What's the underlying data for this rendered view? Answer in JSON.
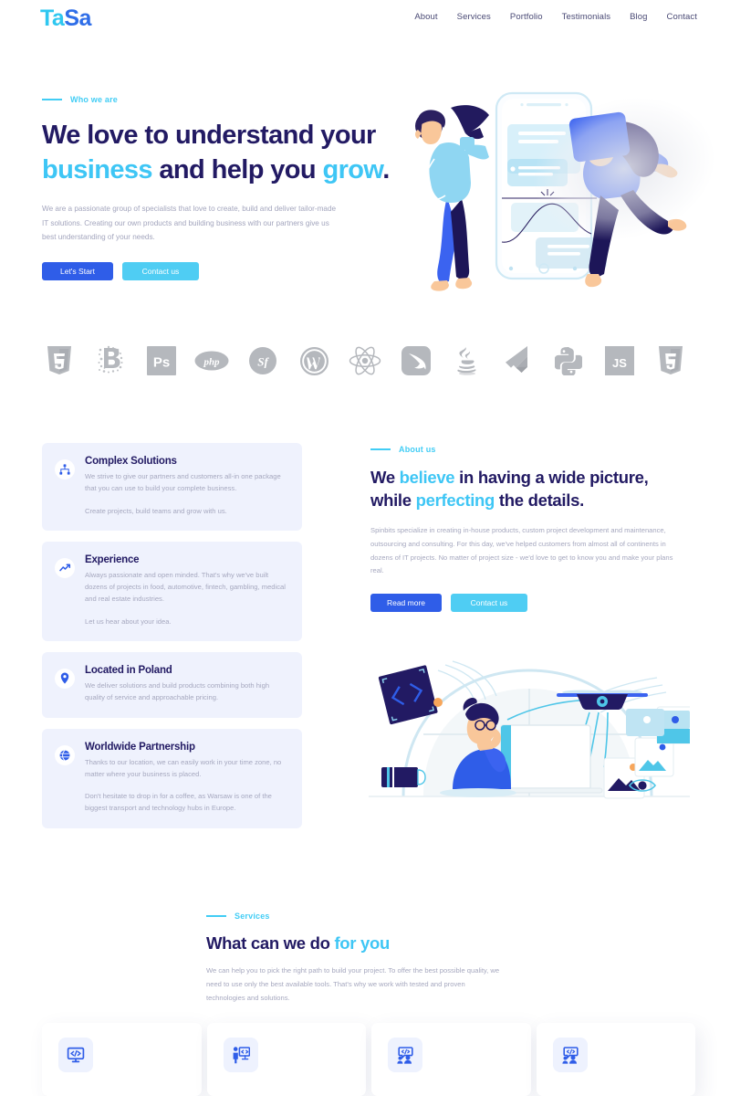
{
  "brand": {
    "part1": "Ta",
    "part2": "Sa",
    "color1": "#2ec7f0",
    "color2": "#2f6ee8"
  },
  "nav": {
    "items": [
      {
        "label": "About"
      },
      {
        "label": "Services"
      },
      {
        "label": "Portfolio"
      },
      {
        "label": "Testimonials"
      },
      {
        "label": "Blog"
      },
      {
        "label": "Contact"
      }
    ]
  },
  "hero": {
    "eyebrow": "Who we are",
    "title_line1_a": "We love to understand your",
    "title_line2_a": "business",
    "title_line2_b": " and help you ",
    "title_line2_c": "grow",
    "title_line2_d": ".",
    "subtitle": "We are a passionate group of specialists that love to create, build and deliver tailor-made IT solutions. Creating our own products and building business with our partners give us best understanding of your needs.",
    "primary_button": "Let's Start",
    "secondary_button": "Contact us",
    "illustration": "two-people-smartphone-illustration"
  },
  "tech_logos": [
    {
      "name": "css3-icon",
      "label": "CSS3"
    },
    {
      "name": "bootstrap-b-icon",
      "label": "B"
    },
    {
      "name": "photoshop-icon",
      "label": "Ps"
    },
    {
      "name": "php-icon",
      "label": "php"
    },
    {
      "name": "symfony-icon",
      "label": "Sf"
    },
    {
      "name": "wordpress-icon",
      "label": "W"
    },
    {
      "name": "react-icon",
      "label": "React"
    },
    {
      "name": "swift-icon",
      "label": "Swift"
    },
    {
      "name": "java-icon",
      "label": "Java"
    },
    {
      "name": "flutter-icon",
      "label": "Flutter"
    },
    {
      "name": "python-icon",
      "label": "Python"
    },
    {
      "name": "javascript-icon",
      "label": "JS"
    },
    {
      "name": "html5-icon",
      "label": "HTML5"
    }
  ],
  "features": [
    {
      "icon": "sitemap-icon",
      "title": "Complex Solutions",
      "text1": "We strive to give our partners and customers all-in one package that you can use to build your complete business.",
      "text2": "Create projects, build teams and grow with us."
    },
    {
      "icon": "trending-up-icon",
      "title": "Experience",
      "text1": "Always passionate and open minded. That's why we've built dozens of projects in food, automotive, fintech, gambling, medical and real estate industries.",
      "text2": "Let us hear about your idea."
    },
    {
      "icon": "map-pin-icon",
      "title": "Located in Poland",
      "text1": "We deliver solutions and build products combining both high quality of service and approachable pricing.",
      "text2": ""
    },
    {
      "icon": "globe-icon",
      "title": "Worldwide Partnership",
      "text1": "Thanks to our location, we can easily work in your time zone, no matter where your business is placed.",
      "text2": "Don't hesitate to drop in for a coffee, as Warsaw is one of the biggest transport and technology hubs in Europe."
    }
  ],
  "about": {
    "eyebrow": "About us",
    "title_a": "We ",
    "title_b": "believe",
    "title_c": " in having a wide picture,",
    "title_d": "while ",
    "title_e": "perfecting",
    "title_f": " the details.",
    "subtitle": "Spinbits specialize in creating in-house products, custom project development and maintenance, outsourcing and consulting. For this day, we've helped customers from almost all of continents in dozens of IT projects. No matter of project size - we'd love to get to know you and make your plans real.",
    "primary_button": "Read more",
    "secondary_button": "Contact us",
    "illustration": "developer-desk-drone-illustration"
  },
  "services": {
    "eyebrow": "Services",
    "title_a": "What can we do ",
    "title_b": "for you",
    "subtitle": "We can help you to pick the right path to build your project. To offer the best possible quality, we need to use only the best available tools. That's why we work with tested and proven technologies and solutions.",
    "cards": [
      {
        "icon": "monitor-code-icon"
      },
      {
        "icon": "presenter-code-icon"
      },
      {
        "icon": "people-code-chat-icon"
      },
      {
        "icon": "people-code-chat-icon"
      }
    ]
  },
  "colors": {
    "accent_cyan": "#3ec6f5",
    "accent_blue": "#2f5de8",
    "heading_navy": "#221a63",
    "body_gray": "#a6a8bf",
    "card_bg": "#eff2fd"
  }
}
